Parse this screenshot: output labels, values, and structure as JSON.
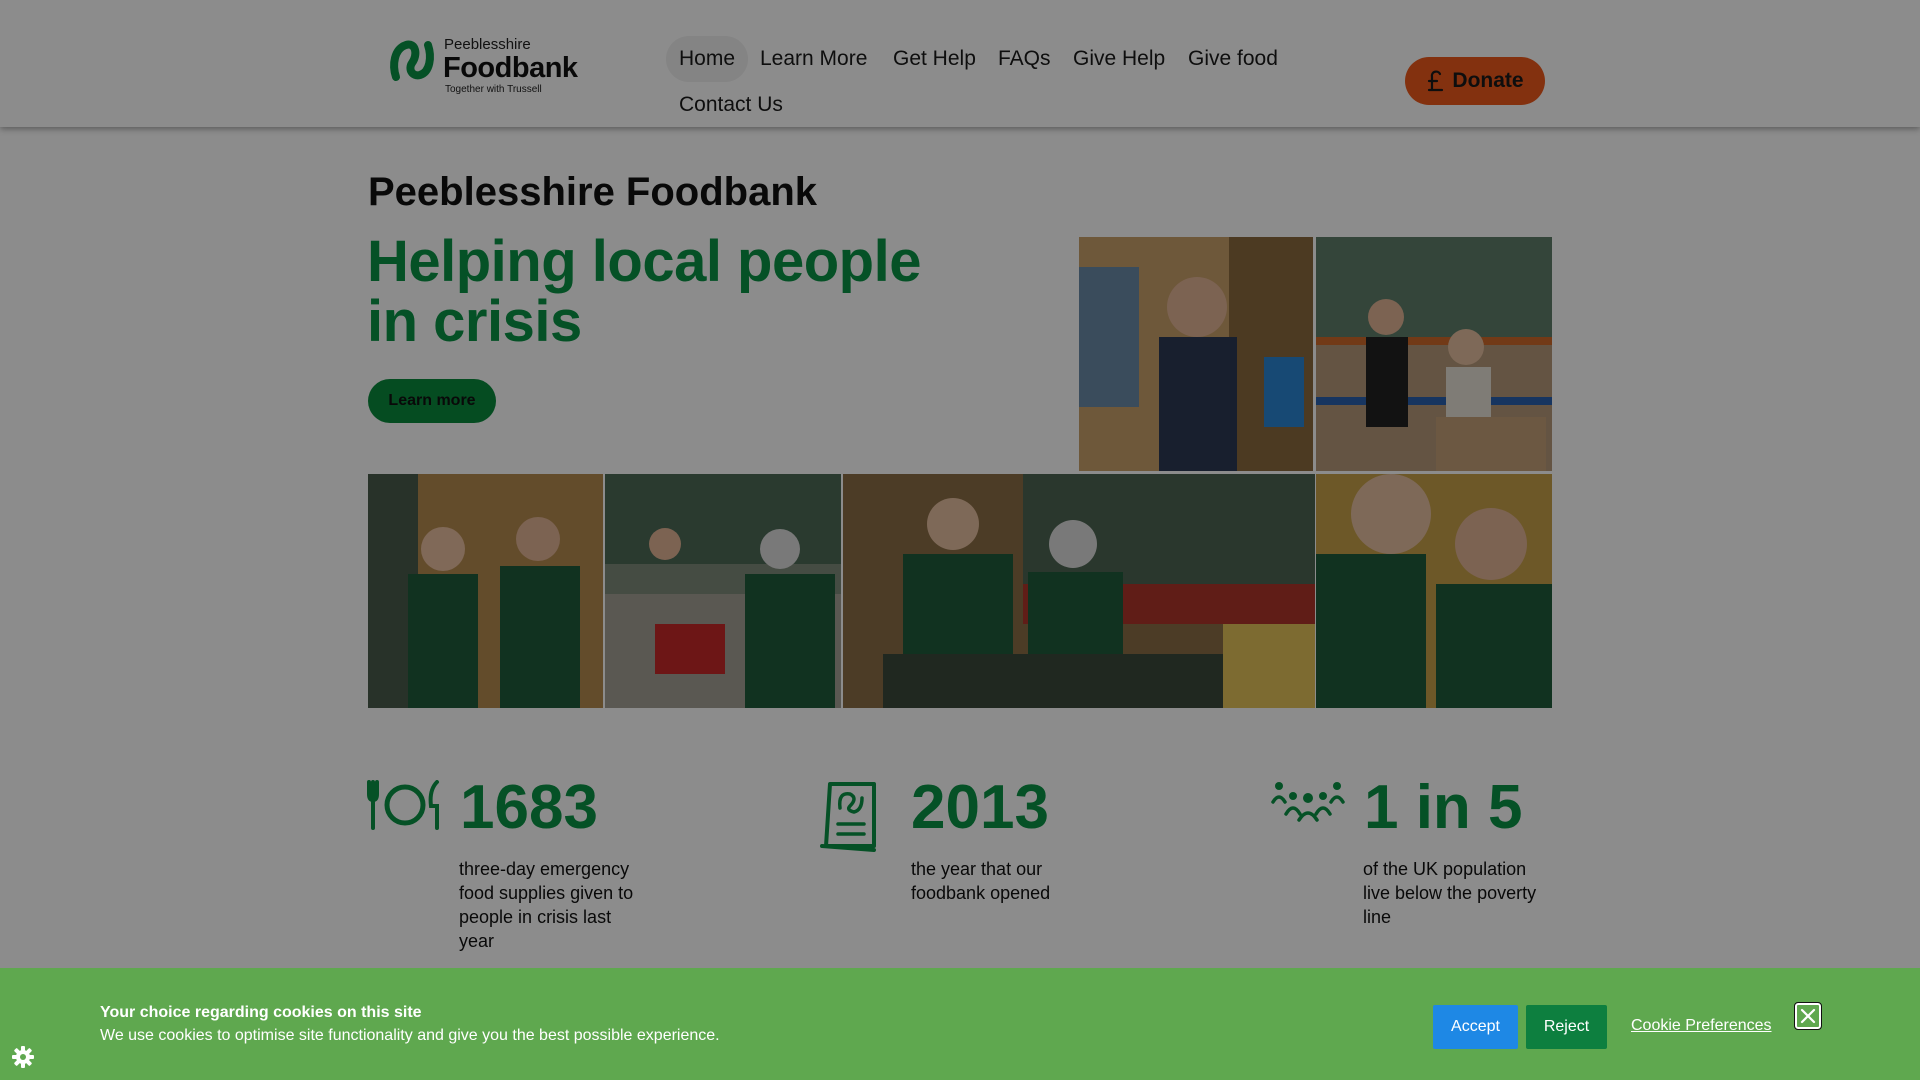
{
  "header": {
    "logo": {
      "line1": "Peeblesshire",
      "line2": "Foodbank",
      "line3": "Together with Trussell"
    },
    "nav": [
      "Home",
      "Learn More",
      "Get Help",
      "FAQs",
      "Give Help",
      "Give food",
      "Contact Us"
    ],
    "active_nav": "Home",
    "donate_label": "Donate"
  },
  "hero": {
    "site_title": "Peeblesshire Foodbank",
    "headline": "Helping local people in crisis",
    "cta_label": "Learn more"
  },
  "stats": [
    {
      "icon": "plate-cutlery-icon",
      "number": "1683",
      "description": "three-day emergency food supplies given to people in crisis last year"
    },
    {
      "icon": "document-icon",
      "number": "2013",
      "description": "the year that our foodbank opened"
    },
    {
      "icon": "people-group-icon",
      "number": "1 in 5",
      "description": "of the UK population live below the poverty line"
    }
  ],
  "cookie_banner": {
    "title": "Your choice regarding cookies on this site",
    "text": "We use cookies to optimise site functionality and give you the best possible experience.",
    "accept_label": "Accept",
    "reject_label": "Reject",
    "preferences_label": "Cookie Preferences"
  },
  "colors": {
    "brand_green": "#0a9445",
    "donate_orange": "#ee5a1c",
    "cookie_green": "#5fa84f",
    "accept_blue": "#1e88e5",
    "reject_green": "#0d7f3f"
  }
}
